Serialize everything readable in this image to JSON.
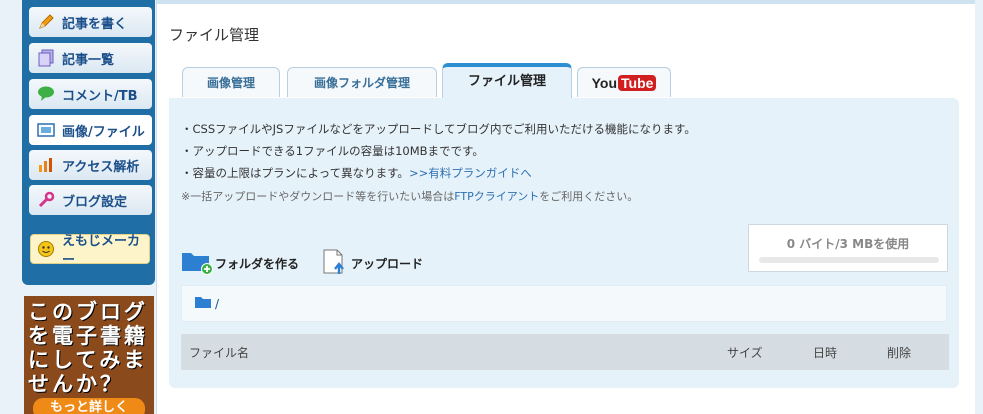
{
  "sidebar": {
    "items": [
      {
        "label": "記事を書く",
        "icon": "pencil-icon"
      },
      {
        "label": "記事一覧",
        "icon": "documents-icon"
      },
      {
        "label": "コメント/TB",
        "icon": "speech-bubble-icon"
      },
      {
        "label": "画像/ファイル",
        "icon": "image-file-icon"
      },
      {
        "label": "アクセス解析",
        "icon": "bar-chart-icon"
      },
      {
        "label": "ブログ設定",
        "icon": "wrench-icon"
      }
    ],
    "emoji_maker": "えもじメーカー",
    "banner": {
      "text": "このブログを電子書籍にしてみませんか？",
      "button": "もっと詳しく"
    }
  },
  "main": {
    "title": "ファイル管理",
    "tabs": [
      {
        "label": "画像管理"
      },
      {
        "label": "画像フォルダ管理"
      },
      {
        "label": "ファイル管理"
      },
      {
        "label": "YouTube"
      }
    ],
    "info": {
      "line1": "・CSSファイルやJSファイルなどをアップロードしてブログ内でご利用いただける機能になります。",
      "line2": "・アップロードできる1ファイルの容量は10MBまでです。",
      "line3": "・容量の上限はプランによって異なります。",
      "line3_link": ">>有料プランガイドへ",
      "note_pre": "※一括アップロードやダウンロード等を行いたい場合は",
      "note_link": "FTPクライアント",
      "note_post": "をご利用ください。"
    },
    "actions": {
      "create_folder": "フォルダを作る",
      "upload": "アップロード"
    },
    "quota": {
      "text": "0 バイト/3 MBを使用",
      "used_fraction": 0
    },
    "path": "/",
    "table": {
      "columns": [
        "ファイル名",
        "サイズ",
        "日時",
        "削除"
      ]
    }
  },
  "colors": {
    "accent": "#2d8fd1",
    "sidebar": "#1f6fa6"
  }
}
